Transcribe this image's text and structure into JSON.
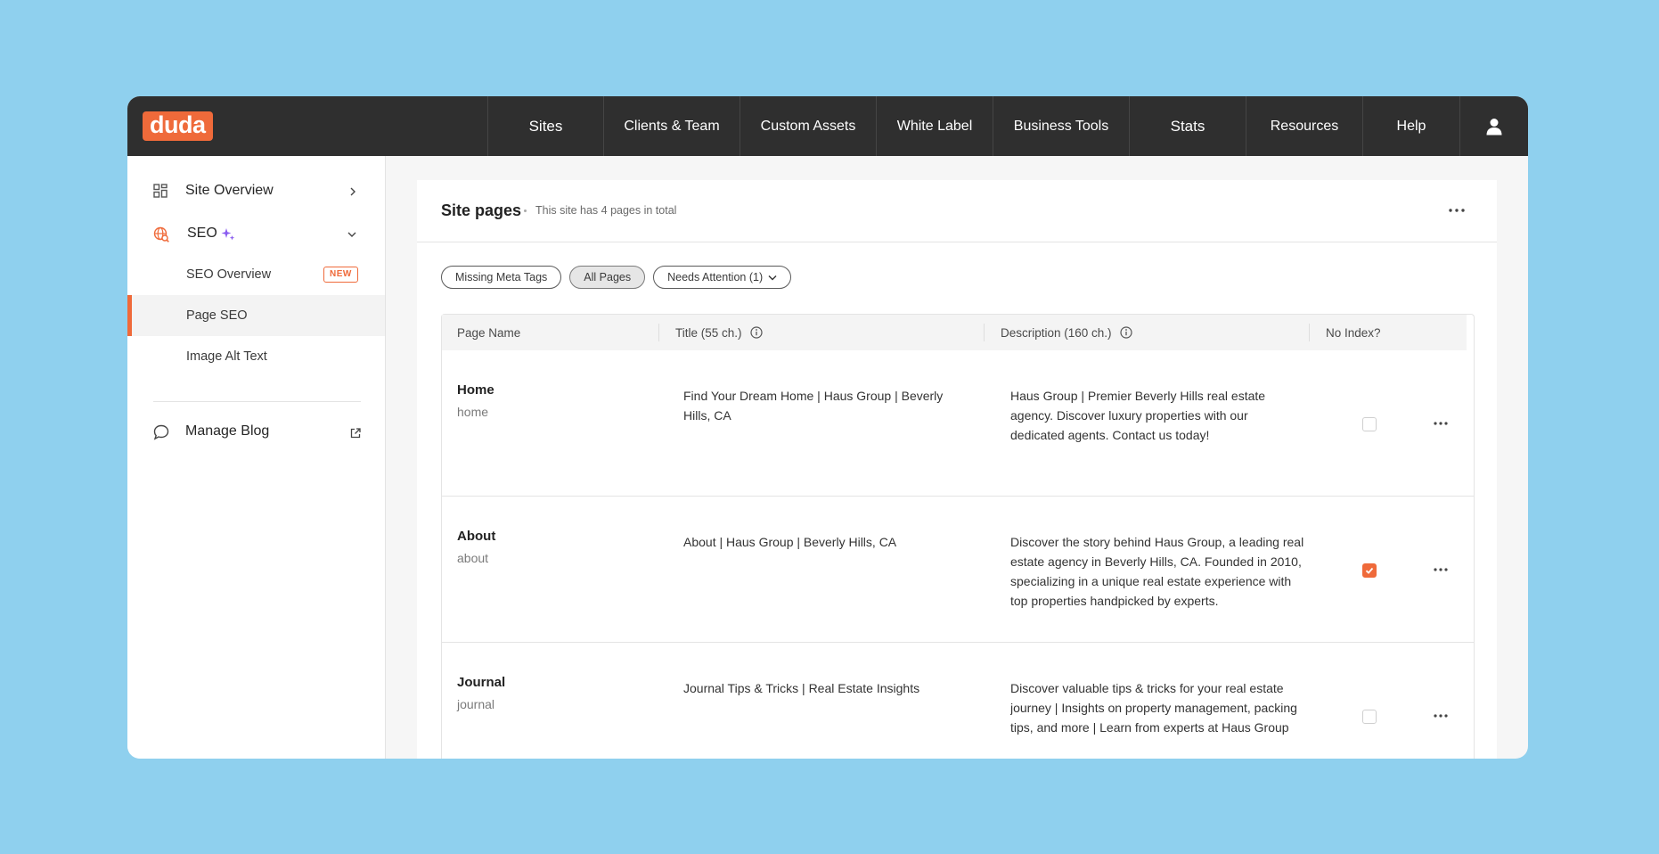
{
  "brand": {
    "logo_text": "duda",
    "accent_color": "#ef6a3a",
    "nav_bg": "#2f2f2f"
  },
  "nav": {
    "items": [
      {
        "label": "Sites"
      },
      {
        "label": "Clients & Team"
      },
      {
        "label": "Custom Assets"
      },
      {
        "label": "White Label"
      },
      {
        "label": "Business Tools"
      },
      {
        "label": "Stats"
      },
      {
        "label": "Resources"
      },
      {
        "label": "Help"
      }
    ],
    "user_icon": "user-icon"
  },
  "sidebar": {
    "site_overview": {
      "label": "Site Overview",
      "icon": "grid-icon"
    },
    "seo": {
      "label": "SEO",
      "icon": "globe-search-icon",
      "sparkle_icon": "sparkle-icon",
      "children": [
        {
          "label": "SEO Overview",
          "badge": "NEW"
        },
        {
          "label": "Page SEO",
          "active": true
        },
        {
          "label": "Image Alt Text"
        }
      ]
    },
    "manage_blog": {
      "label": "Manage Blog",
      "icon": "chat-bubble-icon",
      "external_icon": "external-link-icon"
    }
  },
  "panel": {
    "title": "Site pages",
    "subtitle": "This site has 4 pages in total",
    "filters": [
      {
        "label": "Missing Meta Tags",
        "selected": false
      },
      {
        "label": "All Pages",
        "selected": true
      },
      {
        "label": "Needs Attention (1)",
        "selected": false
      }
    ],
    "table": {
      "headers": {
        "page_name": "Page Name",
        "title": "Title (55 ch.)",
        "description": "Description (160 ch.)",
        "no_index": "No Index?"
      },
      "rows": [
        {
          "name": "Home",
          "slug": "home",
          "title": "Find Your Dream Home | Haus Group | Beverly Hills, CA",
          "description": "Haus Group | Premier Beverly Hills real estate agency. Discover luxury properties with our dedicated agents. Contact us today!",
          "no_index": false
        },
        {
          "name": "About",
          "slug": "about",
          "title": "About | Haus Group | Beverly Hills, CA",
          "description": "Discover the story behind Haus Group, a leading real estate agency in Beverly Hills, CA. Founded in 2010, specializing in a unique real estate experience with top properties handpicked by experts.",
          "no_index": true
        },
        {
          "name": "Journal",
          "slug": "journal",
          "title": "Journal Tips & Tricks | Real Estate Insights",
          "description": "Discover valuable tips & tricks for your real estate journey | Insights on property management, packing tips, and more | Learn from experts at Haus Group",
          "no_index": false
        }
      ]
    }
  }
}
